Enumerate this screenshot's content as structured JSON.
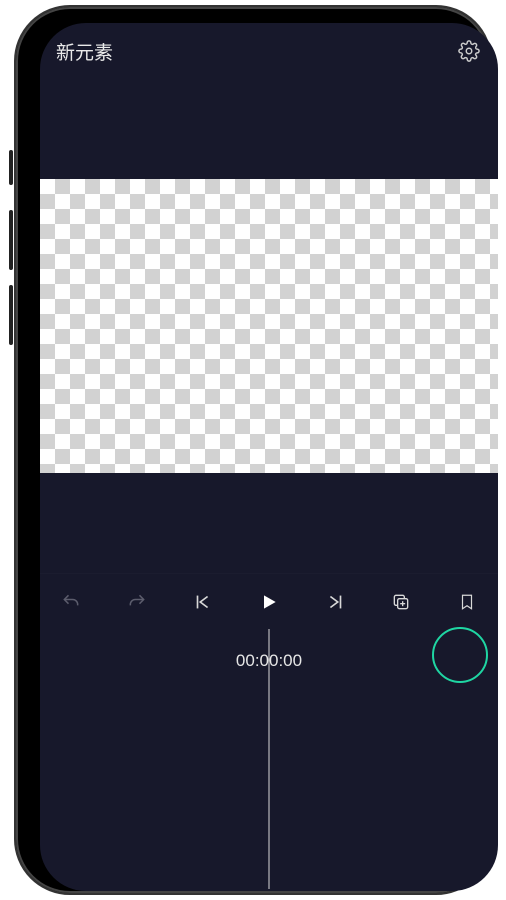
{
  "header": {
    "title": "新元素",
    "settings_icon": "gear"
  },
  "toolbar": {
    "undo_icon": "undo",
    "redo_icon": "redo",
    "go_start_icon": "go-start",
    "play_icon": "play",
    "go_end_icon": "go-end",
    "copy_icon": "copy",
    "bookmark_icon": "bookmark"
  },
  "timeline": {
    "current_time": "00:00:00"
  },
  "colors": {
    "background": "#17182b",
    "accent": "#1fd6a3",
    "text": "#e6e6e6"
  }
}
